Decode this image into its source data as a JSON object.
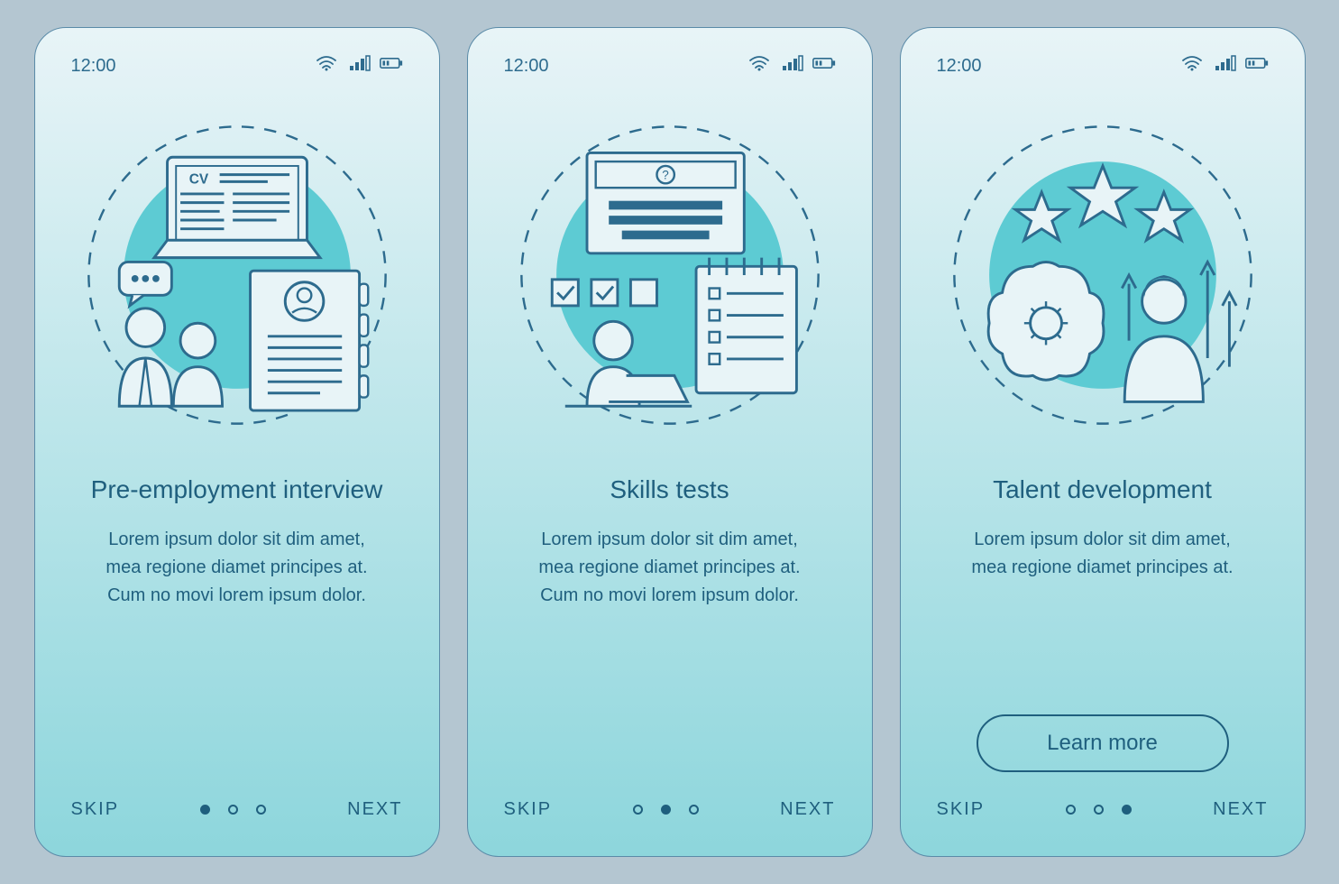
{
  "status": {
    "time": "12:00"
  },
  "screens": [
    {
      "title": "Pre-employment interview",
      "description": "Lorem ipsum dolor sit dim amet, mea regione diamet principes at. Cum no movi lorem ipsum dolor.",
      "skip": "SKIP",
      "next": "NEXT",
      "active_dot": 0,
      "cta": null
    },
    {
      "title": "Skills tests",
      "description": "Lorem ipsum dolor sit dim amet, mea regione diamet principes at. Cum no movi lorem ipsum dolor.",
      "skip": "SKIP",
      "next": "NEXT",
      "active_dot": 1,
      "cta": null
    },
    {
      "title": "Talent development",
      "description": "Lorem ipsum dolor sit dim amet, mea regione diamet principes at.",
      "skip": "SKIP",
      "next": "NEXT",
      "active_dot": 2,
      "cta": "Learn more"
    }
  ],
  "colors": {
    "stroke": "#2D6B8E",
    "accent": "#5DCBD3",
    "bg_circle": "#5DCBD3"
  }
}
